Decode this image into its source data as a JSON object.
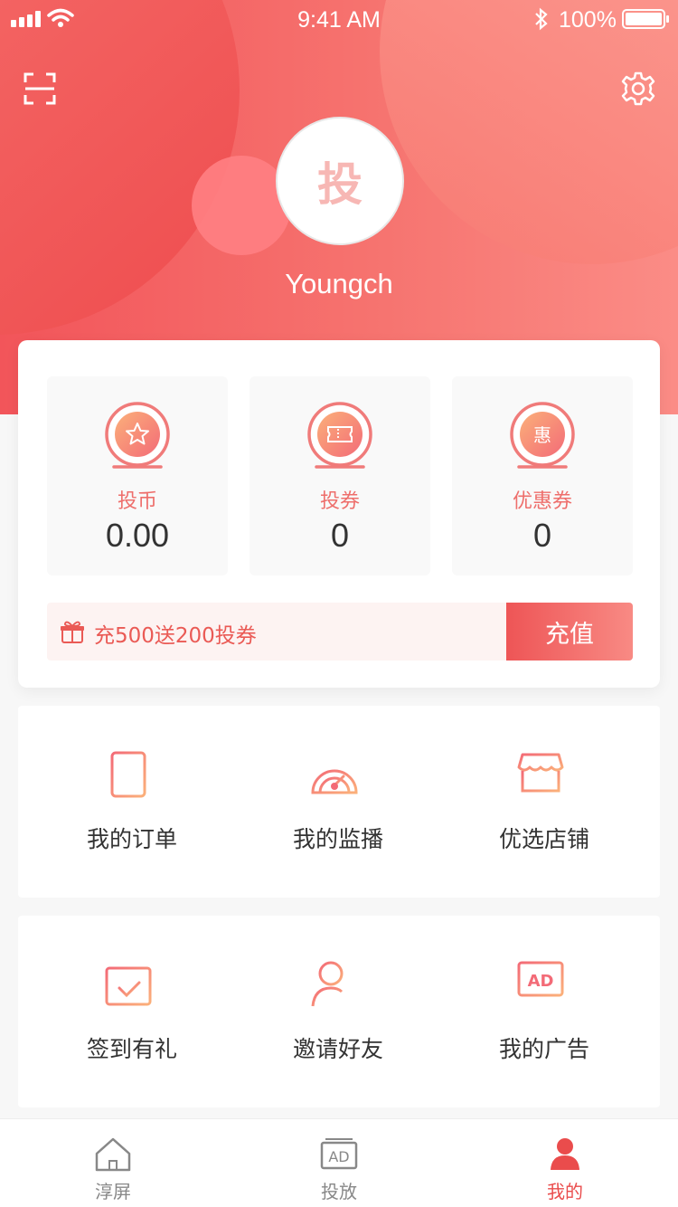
{
  "status_bar": {
    "time": "9:41 AM",
    "battery": "100%"
  },
  "header": {
    "avatar_char": "投",
    "username": "Youngch"
  },
  "assets": [
    {
      "label": "投币",
      "value": "0.00",
      "icon": "coin-star-icon"
    },
    {
      "label": "投券",
      "value": "0",
      "icon": "ticket-icon"
    },
    {
      "label": "优惠券",
      "value": "0",
      "icon": "discount-badge-icon",
      "icon_char": "惠"
    }
  ],
  "promo": {
    "text": "充500送200投券",
    "button": "充值"
  },
  "menu_row1": [
    {
      "label": "我的订单",
      "icon": "order-list-icon"
    },
    {
      "label": "我的监播",
      "icon": "monitor-gauge-icon"
    },
    {
      "label": "优选店铺",
      "icon": "store-icon"
    }
  ],
  "menu_row2": [
    {
      "label": "签到有礼",
      "icon": "calendar-check-icon"
    },
    {
      "label": "邀请好友",
      "icon": "add-friend-icon"
    },
    {
      "label": "我的广告",
      "icon": "ad-screen-icon",
      "icon_text": "AD"
    }
  ],
  "tabs": [
    {
      "label": "淳屏",
      "icon": "home-icon",
      "active": false
    },
    {
      "label": "投放",
      "icon": "ad-tab-icon",
      "icon_text": "AD",
      "active": false
    },
    {
      "label": "我的",
      "icon": "profile-icon",
      "active": true
    }
  ],
  "colors": {
    "accent": "#ea4c4c",
    "header_start": "#f2555a",
    "header_end": "#fb8c86"
  }
}
